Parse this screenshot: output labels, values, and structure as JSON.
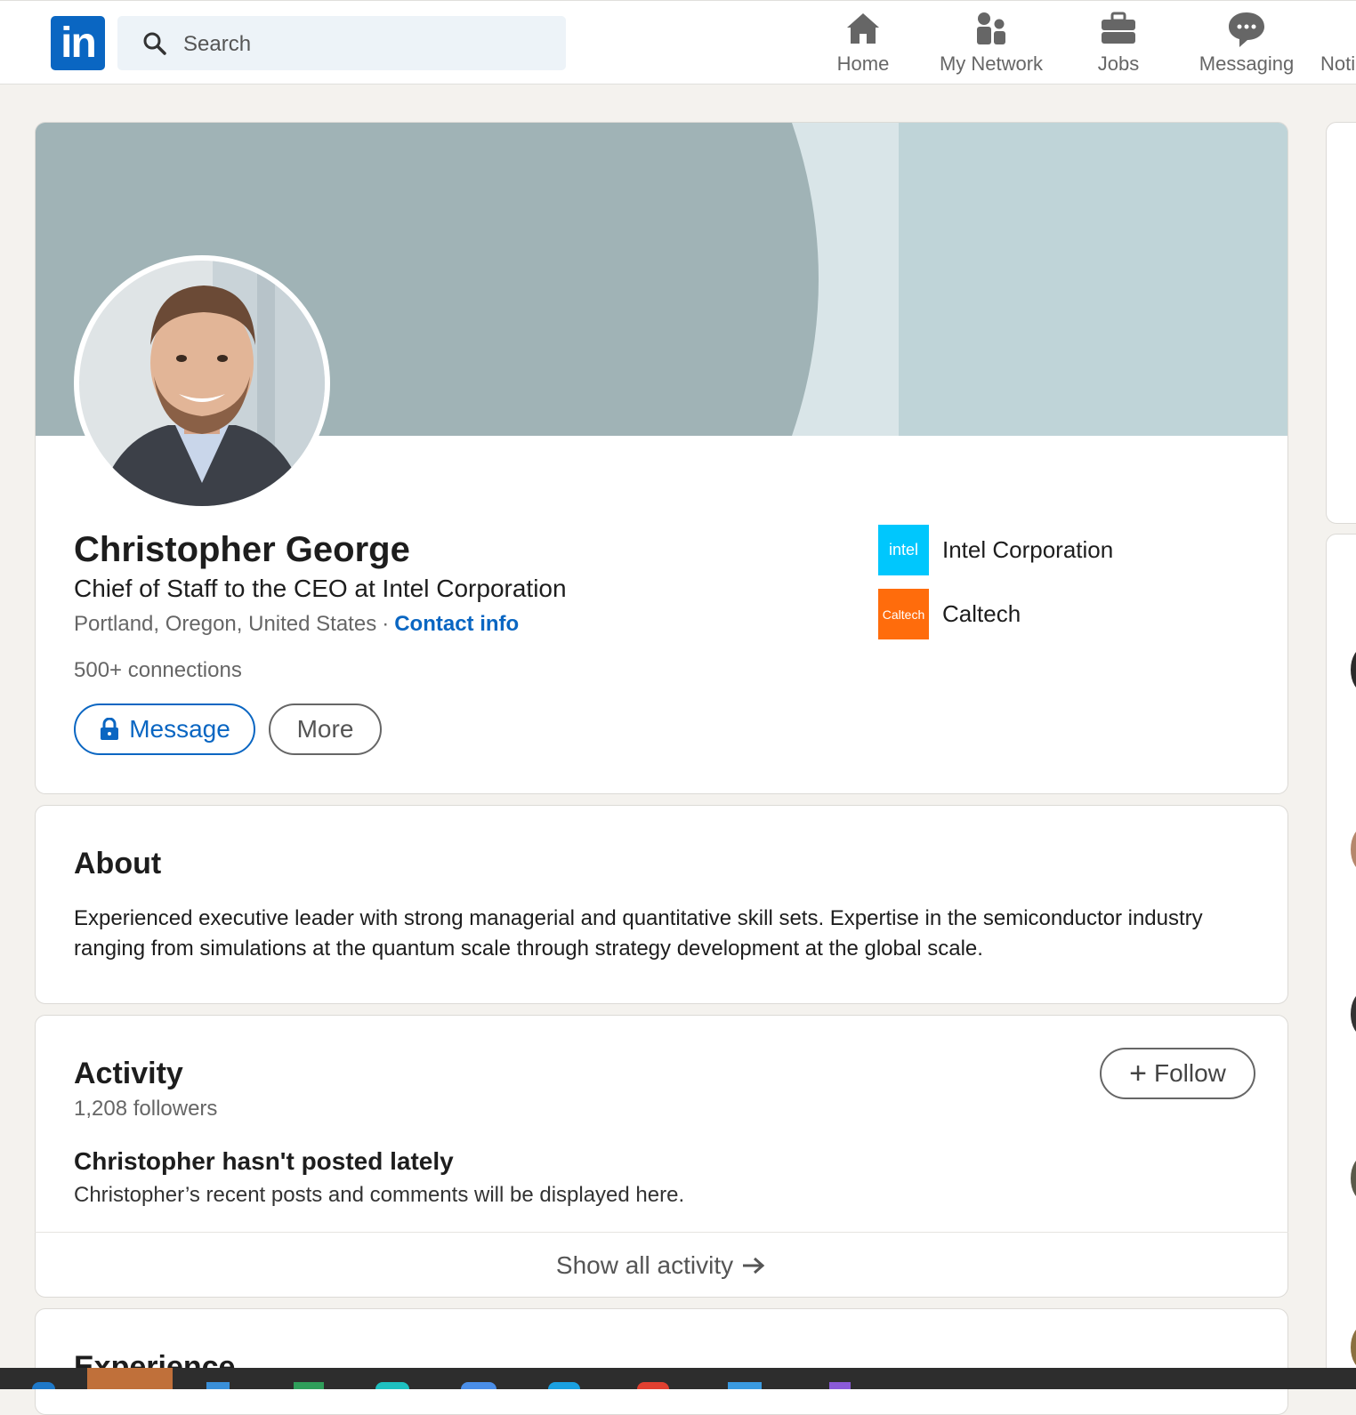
{
  "nav": {
    "search_placeholder": "Search",
    "items": [
      {
        "label": "Home",
        "icon": "home-icon"
      },
      {
        "label": "My Network",
        "icon": "network-icon"
      },
      {
        "label": "Jobs",
        "icon": "briefcase-icon"
      },
      {
        "label": "Messaging",
        "icon": "chat-icon"
      },
      {
        "label": "Noti",
        "icon": "bell-icon"
      }
    ],
    "logo_text": "in"
  },
  "profile": {
    "name": "Christopher George",
    "headline": "Chief of Staff to the CEO at Intel Corporation",
    "location": "Portland, Oregon, United States",
    "separator": "·",
    "contact_info": "Contact info",
    "connections": "500+ connections",
    "message_label": "Message",
    "more_label": "More",
    "orgs": [
      {
        "name": "Intel Corporation",
        "logo_text": "intel",
        "color": "#00c7fd"
      },
      {
        "name": "Caltech",
        "logo_text": "Caltech",
        "color": "#ff6c0c"
      }
    ]
  },
  "about": {
    "title": "About",
    "text": "Experienced executive leader with strong managerial and quantitative skill sets. Expertise in the semiconductor industry ranging from simulations at the quantum scale through strategy development at the global scale."
  },
  "activity": {
    "title": "Activity",
    "followers": "1,208 followers",
    "follow_label": "Follow",
    "empty_title": "Christopher hasn't posted lately",
    "empty_sub": "Christopher’s recent posts and comments will be displayed here.",
    "show_all": "Show all activity"
  },
  "experience": {
    "title": "Experience"
  },
  "colors": {
    "brand": "#0a66c2",
    "banner_dark": "#a0b3b6",
    "banner_light": "#bfd4d8",
    "background": "#f4f2ee"
  }
}
